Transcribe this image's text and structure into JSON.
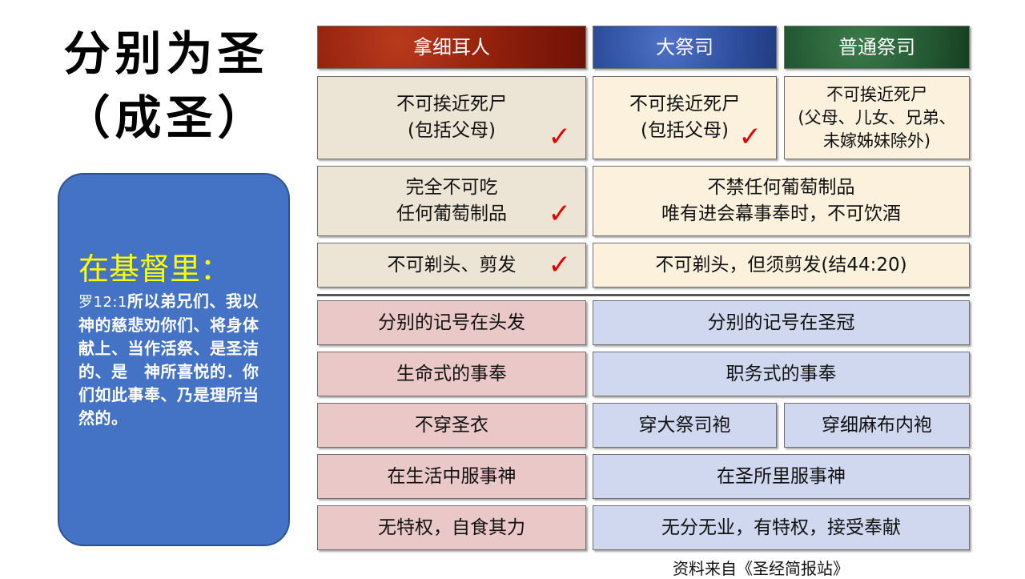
{
  "title": {
    "line1": "分别为圣",
    "line2": "（成圣）"
  },
  "sidebar": {
    "heading": "在基督里：",
    "verse_ref": "罗12:1",
    "verse_text": "所以弟兄们、我以　神的慈悲劝你们、将身体献上、当作活祭、是圣洁的、是　神所喜悦的．你们如此事奉、乃是理所当然的。"
  },
  "table": {
    "headers": [
      "拿细耳人",
      "大祭司",
      "普通祭司"
    ],
    "rows": [
      {
        "c1": "不可挨近死尸\n(包括父母)",
        "c1_check": "✓",
        "c2": "不可挨近死尸\n(包括父母)",
        "c2_check": "✓",
        "c3": "不可挨近死尸\n(父母、儿女、兄弟、\n未嫁姊妹除外)"
      },
      {
        "c1": "完全不可吃\n任何葡萄制品",
        "c1_check": "✓",
        "c23": "不禁任何葡萄制品\n唯有进会幕事奉时，不可饮酒"
      },
      {
        "c1": "不可剃头、剪发",
        "c1_check": "✓",
        "c23": "不可剃头，但须剪发(结44:20)"
      },
      {
        "c1": "分别的记号在头发",
        "c23": "分别的记号在圣冠"
      },
      {
        "c1": "生命式的事奉",
        "c23": "职务式的事奉"
      },
      {
        "c1": "不穿圣衣",
        "c2": "穿大祭司袍",
        "c3": "穿细麻布内袍"
      },
      {
        "c1": "在生活中服事神",
        "c23": "在圣所里服事神"
      },
      {
        "c1": "无特权，自食其力",
        "c23": "无分无业，有特权，接受奉献"
      }
    ]
  },
  "source": "资料来自《圣经简报站》",
  "colors": {
    "header_nazirite": "#8e1e0c",
    "header_high_priest": "#2f4f9e",
    "header_priest": "#245a33",
    "sidebar_bg": "#4472c4",
    "sidebar_heading": "#ffff00",
    "check": "#e00000"
  }
}
